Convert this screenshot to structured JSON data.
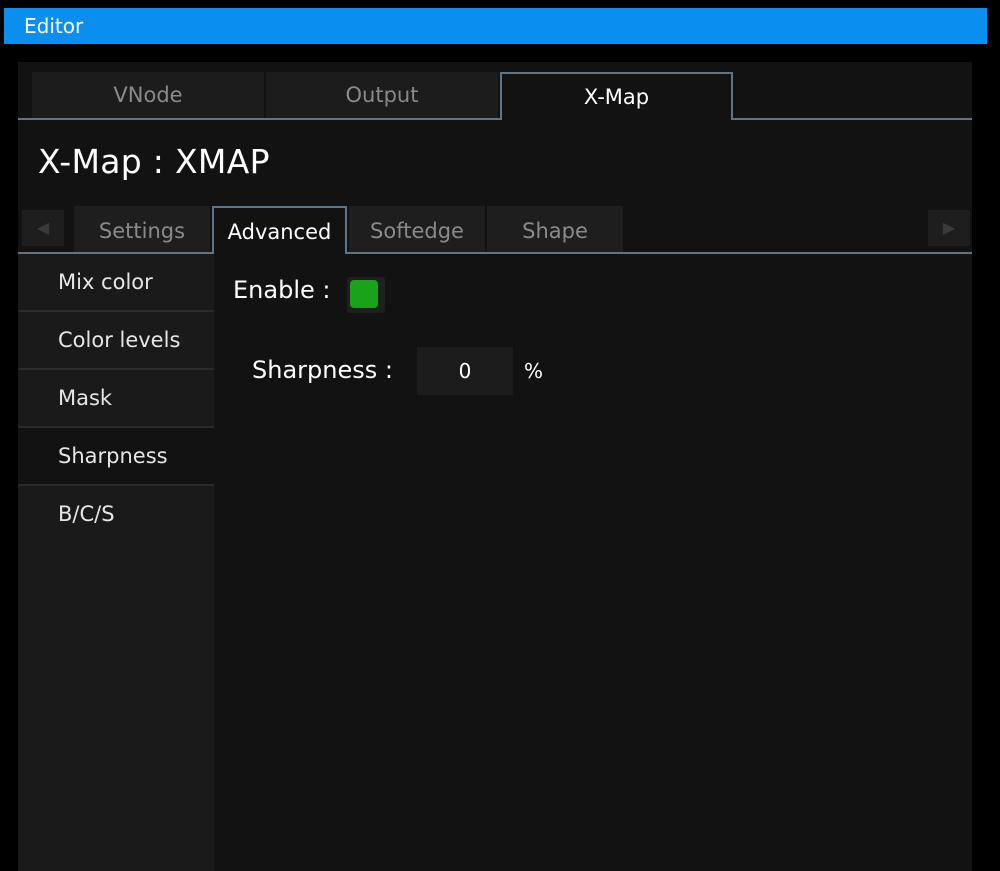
{
  "window": {
    "title": "Editor"
  },
  "top_tabs": [
    {
      "label": "VNode"
    },
    {
      "label": "Output"
    },
    {
      "label": "X-Map"
    }
  ],
  "heading": "X-Map : XMAP",
  "sub_tabs": [
    {
      "label": "Settings"
    },
    {
      "label": "Advanced"
    },
    {
      "label": "Softedge"
    },
    {
      "label": "Shape"
    }
  ],
  "side_menu": [
    {
      "label": "Mix color"
    },
    {
      "label": "Color levels"
    },
    {
      "label": "Mask"
    },
    {
      "label": "Sharpness"
    },
    {
      "label": "B/C/S"
    }
  ],
  "icons": {
    "scroll_left": "left-arrow-icon",
    "scroll_right": "right-arrow-icon"
  },
  "form": {
    "enable_label": "Enable :",
    "enable_on": true,
    "sharpness_label": "Sharpness :",
    "sharpness_value": "0",
    "sharpness_unit": "%"
  },
  "colors": {
    "title_bar": "#0a8ff0",
    "accent_line": "#5e7588",
    "enable_on": "#1aa31a"
  }
}
